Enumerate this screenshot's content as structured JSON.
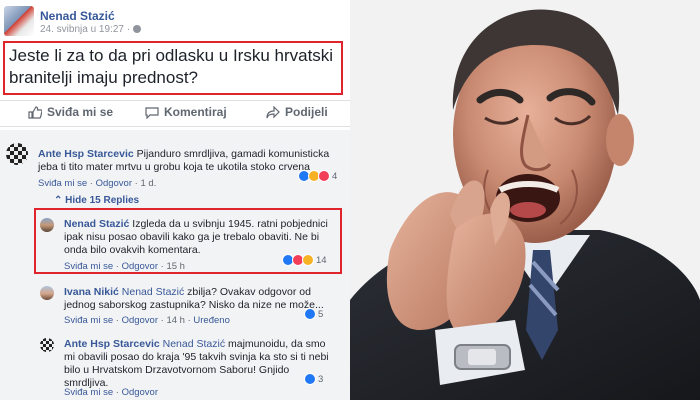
{
  "post": {
    "author": "Nenad Stazić",
    "date": "24. svibnja u 19:27 ·",
    "text": "Jeste li za to da pri odlasku u Irsku hrvatski branitelji imaju prednost?"
  },
  "actions": {
    "like": "Sviđa mi se",
    "comment": "Komentiraj",
    "share": "Podijeli"
  },
  "comments": [
    {
      "author": "Ante Hsp Starcevic",
      "text": " Pijanduro smrdljiva, gamadi komunisticka jeba ti tito mater mrtvu u grobu koja te ukotila stoko crvena",
      "like": "Sviđa mi se",
      "reply": "Odgovor",
      "time": "1 d.",
      "reactions": "4"
    },
    {
      "author": "Nenad Stazić",
      "text": " Izgleda da u svibnju 1945. ratni pobjednici ipak nisu posao obavili kako ga je trebalo obaviti. Ne bi onda bilo ovakvih komentara.",
      "like": "Sviđa mi se",
      "reply": "Odgovor",
      "time": "15 h",
      "reactions": "14"
    },
    {
      "author": "Ivana Nikić",
      "mention": " Nenad Stazić",
      "text": " zbilja? Ovakav odgovor od jednog saborskog zastupnika? Nisko da nize ne može...",
      "like": "Sviđa mi se",
      "reply": "Odgovor",
      "time": "14 h",
      "edited": "Uređeno",
      "reactions": "5"
    },
    {
      "author": "Ante Hsp Starcevic",
      "mention": " Nenad Stazić",
      "text": " majmunoidu, da smo mi obavili posao do kraja '95 takvih svinja ka sto si ti nebi bilo u Hrvatskom Drzavotvornom Saboru! Gnjido smrdljiva.",
      "like": "Sviđa mi se",
      "reply": "Odgovor",
      "time": "",
      "reactions": "3"
    }
  ],
  "hide_replies": "Hide 15 Replies",
  "colors": {
    "link": "#385898",
    "highlight": "#e0242b",
    "comment_bg": "#f2f3f5"
  }
}
